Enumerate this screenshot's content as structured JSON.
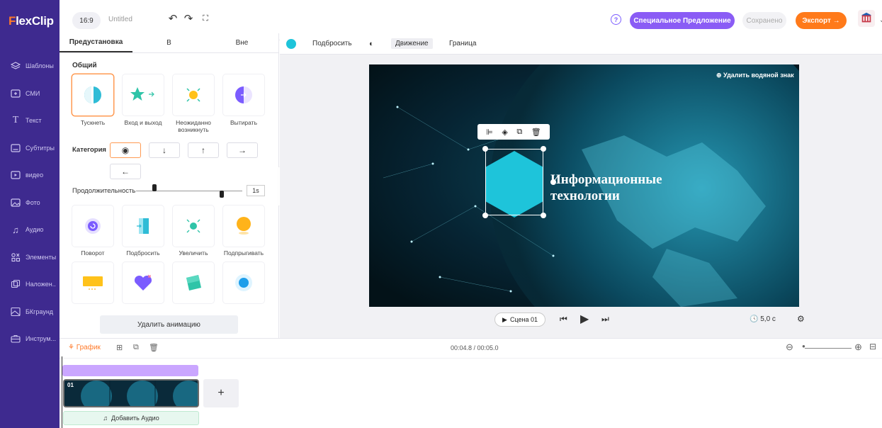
{
  "app": {
    "logo_prefix": "F",
    "logo_rest": "lexClip"
  },
  "sidebar": {
    "items": [
      {
        "label": "Шаблоны",
        "icon": "layers-icon"
      },
      {
        "label": "СМИ",
        "icon": "media-icon"
      },
      {
        "label": "Текст",
        "icon": "text-icon"
      },
      {
        "label": "Субтитры",
        "icon": "subtitles-icon"
      },
      {
        "label": "видео",
        "icon": "video-icon"
      },
      {
        "label": "Фото",
        "icon": "photo-icon"
      },
      {
        "label": "Аудио",
        "icon": "music-icon"
      },
      {
        "label": "Элементы",
        "icon": "elements-icon"
      },
      {
        "label": "Наложен..",
        "icon": "overlay-icon"
      },
      {
        "label": "БКграунд",
        "icon": "background-icon"
      },
      {
        "label": "Инструм...",
        "icon": "tools-icon"
      }
    ]
  },
  "topbar": {
    "ratio": "16:9",
    "title": "Untitled",
    "help": "?",
    "special_offer": "Специальное Предложение",
    "saved": "Сохранено",
    "export": "Экспорт →"
  },
  "panel": {
    "tabs": [
      "Предустановка",
      "В",
      "Вне"
    ],
    "general_title": "Общий",
    "anims_top": [
      {
        "label": "Тускнеть"
      },
      {
        "label": "Вход и выход"
      },
      {
        "label": "Неожиданно возникнуть"
      },
      {
        "label": "Вытирать"
      }
    ],
    "category_label": "Категория",
    "directions": [
      "◉",
      "↓",
      "↑",
      "→",
      "←"
    ],
    "duration_label": "Продолжительность",
    "duration_value": "1s",
    "anims_bottom": [
      {
        "label": "Поворот"
      },
      {
        "label": "Подбросить"
      },
      {
        "label": "Увеличить"
      },
      {
        "label": "Подпрыгивать"
      }
    ],
    "delete_label": "Удалить анимацию"
  },
  "canvas_toolbar": {
    "accent_color": "#1ec4da",
    "toss": "Подбросить",
    "motion": "Движение",
    "border": "Граница"
  },
  "canvas": {
    "watermark": "⊕ Удалить водяной знак",
    "title_line1": "Информационные",
    "title_line2": "технологии"
  },
  "player": {
    "scene": "Сцена 01",
    "duration": "5,0 с"
  },
  "timeline": {
    "graph": "График",
    "time": "00:04.8 / 00:05.0",
    "clip_number": "01",
    "add_audio": "Добавить Аудио"
  }
}
